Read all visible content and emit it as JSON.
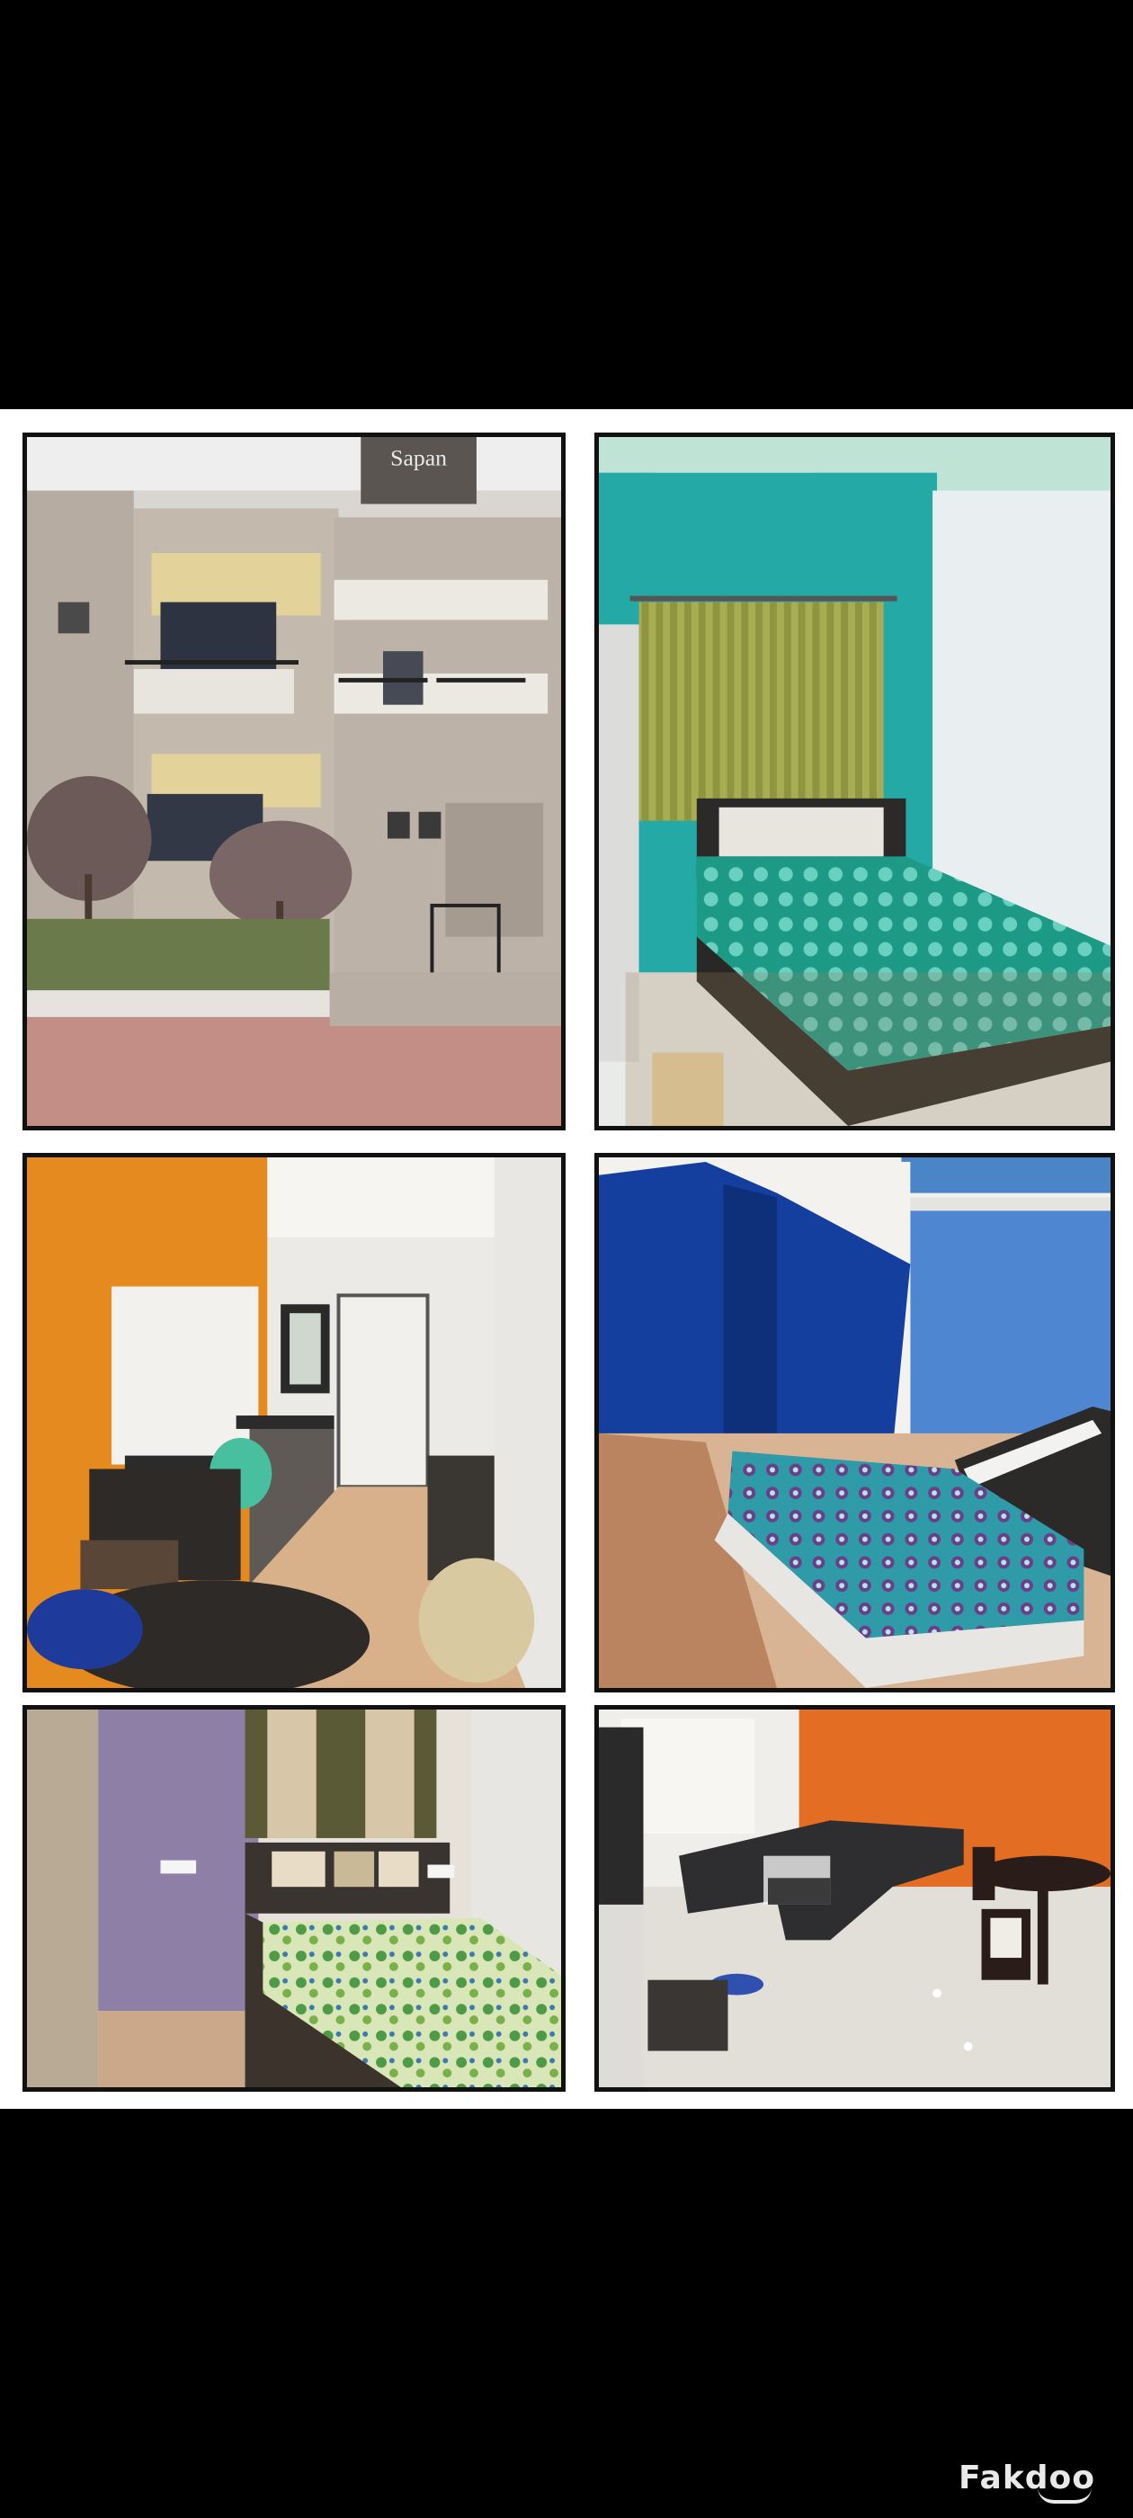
{
  "photos": [
    {
      "id": "building-exterior",
      "sign_text": "Sapan",
      "sign_subtext": "..."
    },
    {
      "id": "bedroom-teal"
    },
    {
      "id": "kitchen-dining"
    },
    {
      "id": "bedroom-blue"
    },
    {
      "id": "bedroom-floral"
    },
    {
      "id": "living-room-sofa"
    }
  ],
  "watermark": {
    "text": "Fakdoo"
  },
  "colors": {
    "background": "#000000",
    "collage_bg": "#ffffff",
    "frame": "#111111"
  }
}
